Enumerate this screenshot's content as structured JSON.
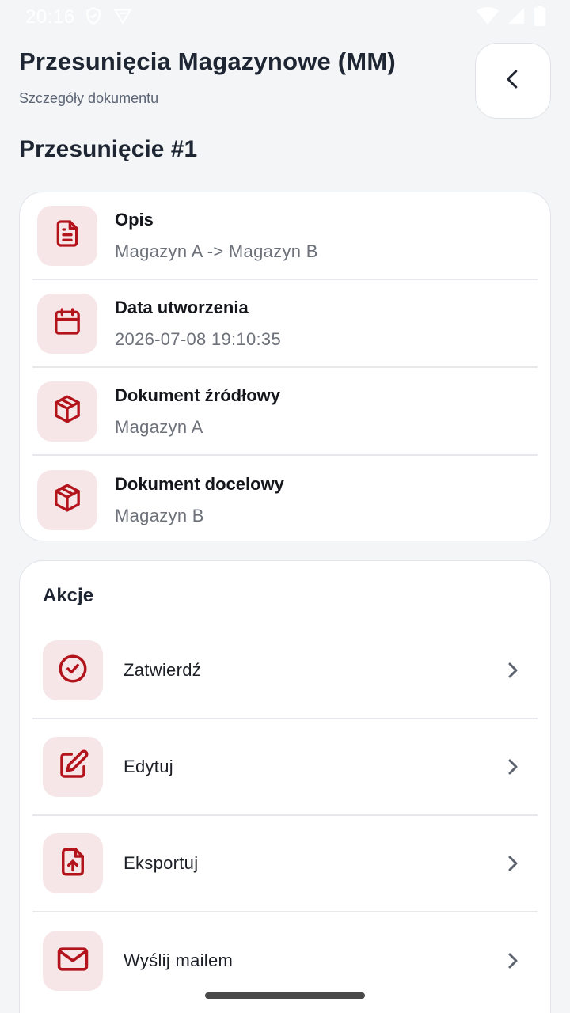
{
  "status_bar": {
    "time": "20:16",
    "icons": [
      "shield-icon",
      "vpn-icon",
      "wifi-icon",
      "signal-icon",
      "battery-icon"
    ]
  },
  "header": {
    "title": "Przesunięcia Magazynowe (MM)",
    "subtitle": "Szczegóły dokumentu",
    "back_icon": "chevron-left-icon"
  },
  "document": {
    "title": "Przesunięcie #1",
    "fields": [
      {
        "icon": "document-icon",
        "label": "Opis",
        "value": "Magazyn A -> Magazyn B"
      },
      {
        "icon": "calendar-icon",
        "label": "Data utworzenia",
        "value": "2026-07-08 19:10:35"
      },
      {
        "icon": "package-icon",
        "label": "Dokument źródłowy",
        "value": "Magazyn A"
      },
      {
        "icon": "package-icon",
        "label": "Dokument docelowy",
        "value": "Magazyn B"
      }
    ]
  },
  "actions": {
    "title": "Akcje",
    "items": [
      {
        "icon": "check-circle-icon",
        "label": "Zatwierdź"
      },
      {
        "icon": "edit-icon",
        "label": "Edytuj"
      },
      {
        "icon": "file-upload-icon",
        "label": "Eksportuj"
      },
      {
        "icon": "mail-icon",
        "label": "Wyślij mailem"
      }
    ]
  },
  "colors": {
    "accent": "#b3141c",
    "icon_bg": "#f7e6e8",
    "background": "#f4f5f7",
    "chevron": "#5d6470"
  }
}
